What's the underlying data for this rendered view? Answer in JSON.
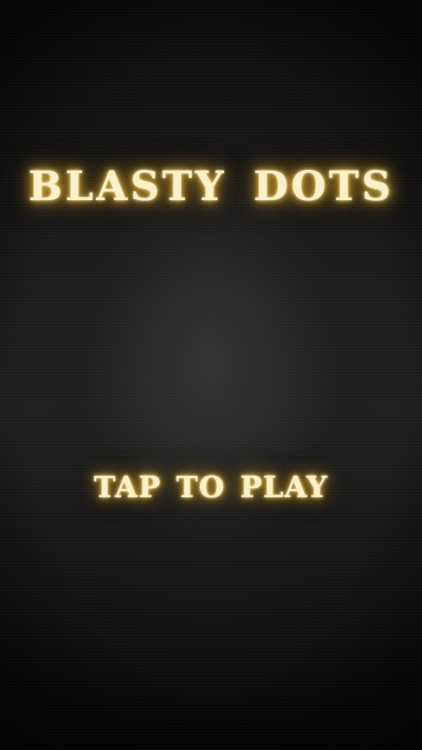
{
  "title": "BLASTY DOTS",
  "play_prompt": "TAP TO PLAY",
  "colors": {
    "text": "#fbf1c9",
    "glow": "#c9982a",
    "background": "#1a1a1a"
  }
}
